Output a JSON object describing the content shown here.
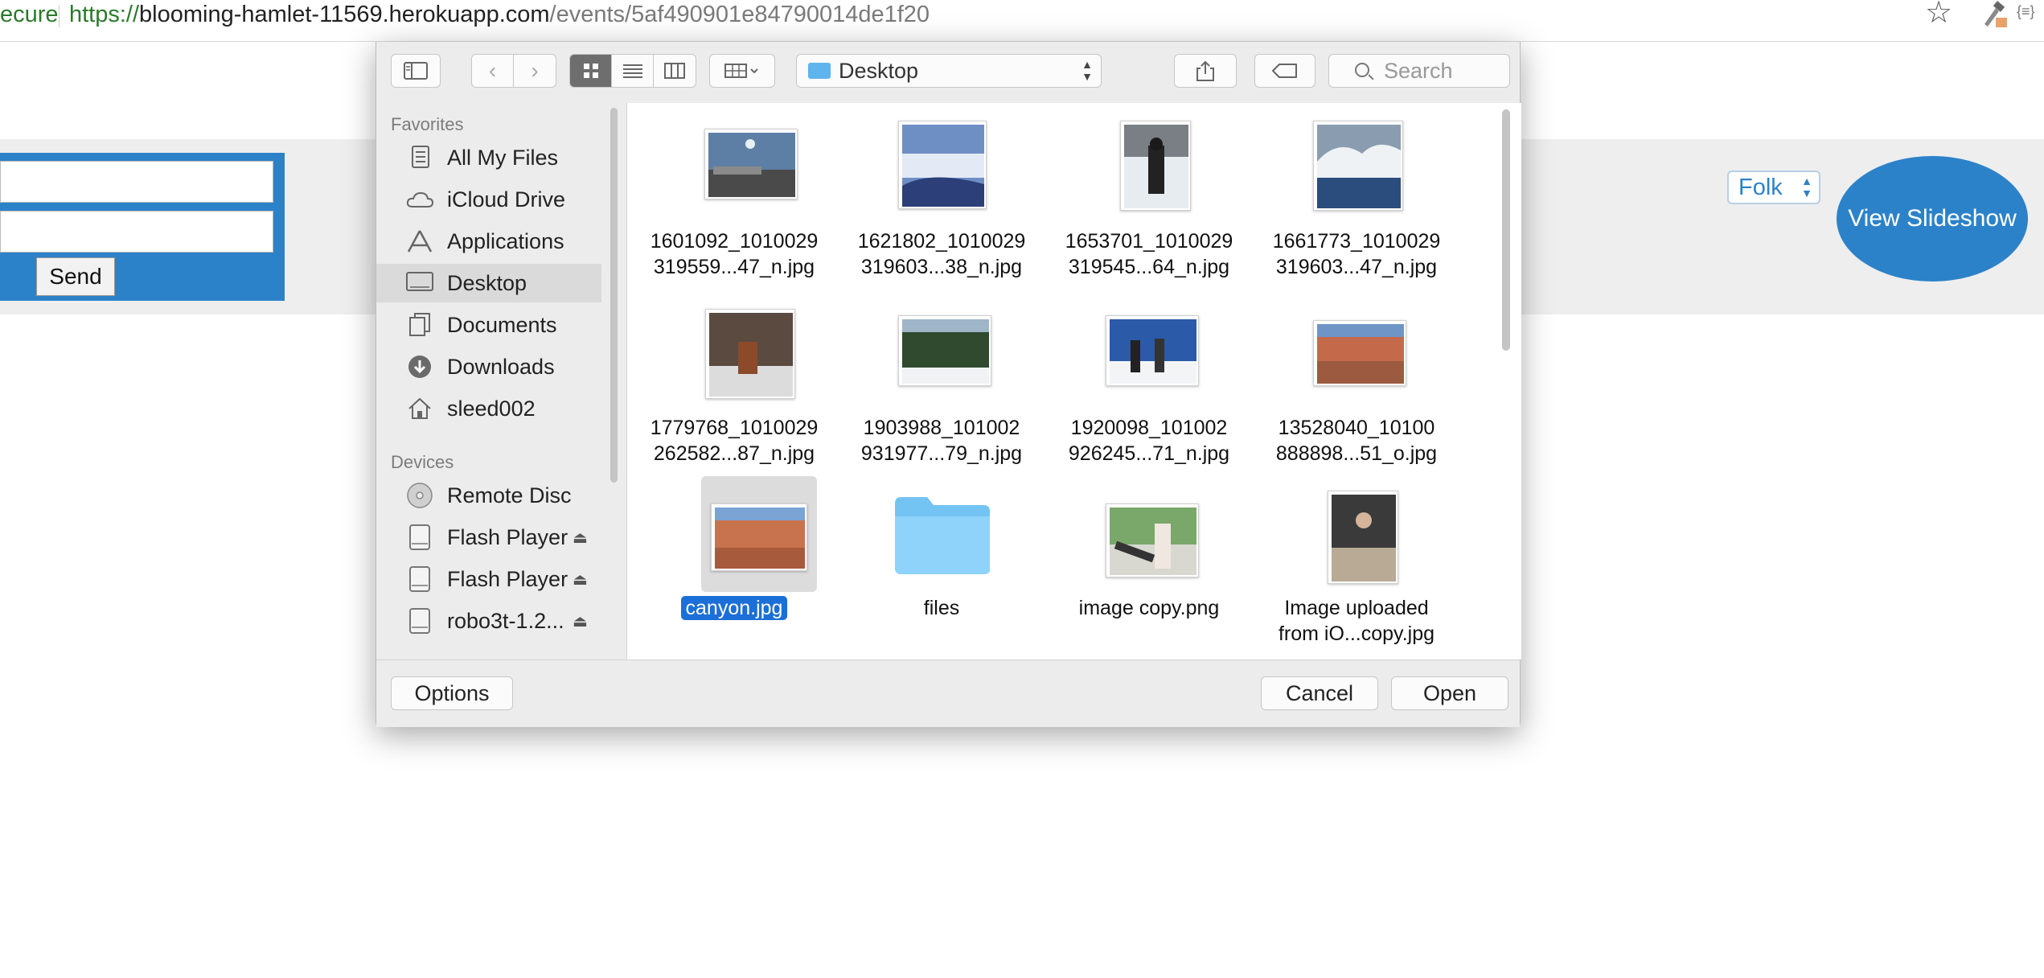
{
  "browser": {
    "secure_text": "ecure",
    "url_scheme": "https://",
    "url_host": "blooming-hamlet-11569.herokuapp.com",
    "url_path": "/events/5af490901e84790014de1f20"
  },
  "page": {
    "send_label": "Send",
    "genre_selected": "Folk",
    "slideshow_label": "View Slideshow",
    "accent_color": "#2c82c9"
  },
  "dialog": {
    "location": "Desktop",
    "search_placeholder": "Search",
    "sidebar": {
      "favorites_heading": "Favorites",
      "favorites": [
        {
          "label": "All My Files",
          "icon": "all-files-icon"
        },
        {
          "label": "iCloud Drive",
          "icon": "cloud-icon"
        },
        {
          "label": "Applications",
          "icon": "applications-icon"
        },
        {
          "label": "Desktop",
          "icon": "desktop-icon",
          "selected": true
        },
        {
          "label": "Documents",
          "icon": "documents-icon"
        },
        {
          "label": "Downloads",
          "icon": "downloads-icon"
        },
        {
          "label": "sleed002",
          "icon": "home-icon"
        }
      ],
      "devices_heading": "Devices",
      "devices": [
        {
          "label": "Remote Disc",
          "icon": "disc-icon"
        },
        {
          "label": "Flash Player",
          "icon": "drive-icon",
          "eject": true
        },
        {
          "label": "Flash Player",
          "icon": "drive-icon",
          "eject": true
        },
        {
          "label": "robo3t-1.2...",
          "icon": "drive-icon",
          "eject": true
        }
      ]
    },
    "files": [
      {
        "line1": "1601092_1010029",
        "line2": "319559...47_n.jpg"
      },
      {
        "line1": "1621802_1010029",
        "line2": "319603...38_n.jpg"
      },
      {
        "line1": "1653701_1010029",
        "line2": "319545...64_n.jpg"
      },
      {
        "line1": "1661773_1010029",
        "line2": "319603...47_n.jpg"
      },
      {
        "line1": "1779768_1010029",
        "line2": "262582...87_n.jpg"
      },
      {
        "line1": "1903988_101002",
        "line2": "931977...79_n.jpg"
      },
      {
        "line1": "1920098_101002",
        "line2": "926245...71_n.jpg"
      },
      {
        "line1": "13528040_10100",
        "line2": "888898...51_o.jpg"
      },
      {
        "line1": "canyon.jpg",
        "line2": "",
        "selected": true
      },
      {
        "line1": "files",
        "line2": "",
        "folder": true
      },
      {
        "line1": "image copy.png",
        "line2": ""
      },
      {
        "line1": "Image uploaded",
        "line2": "from iO...copy.jpg"
      }
    ],
    "options_label": "Options",
    "cancel_label": "Cancel",
    "open_label": "Open"
  }
}
